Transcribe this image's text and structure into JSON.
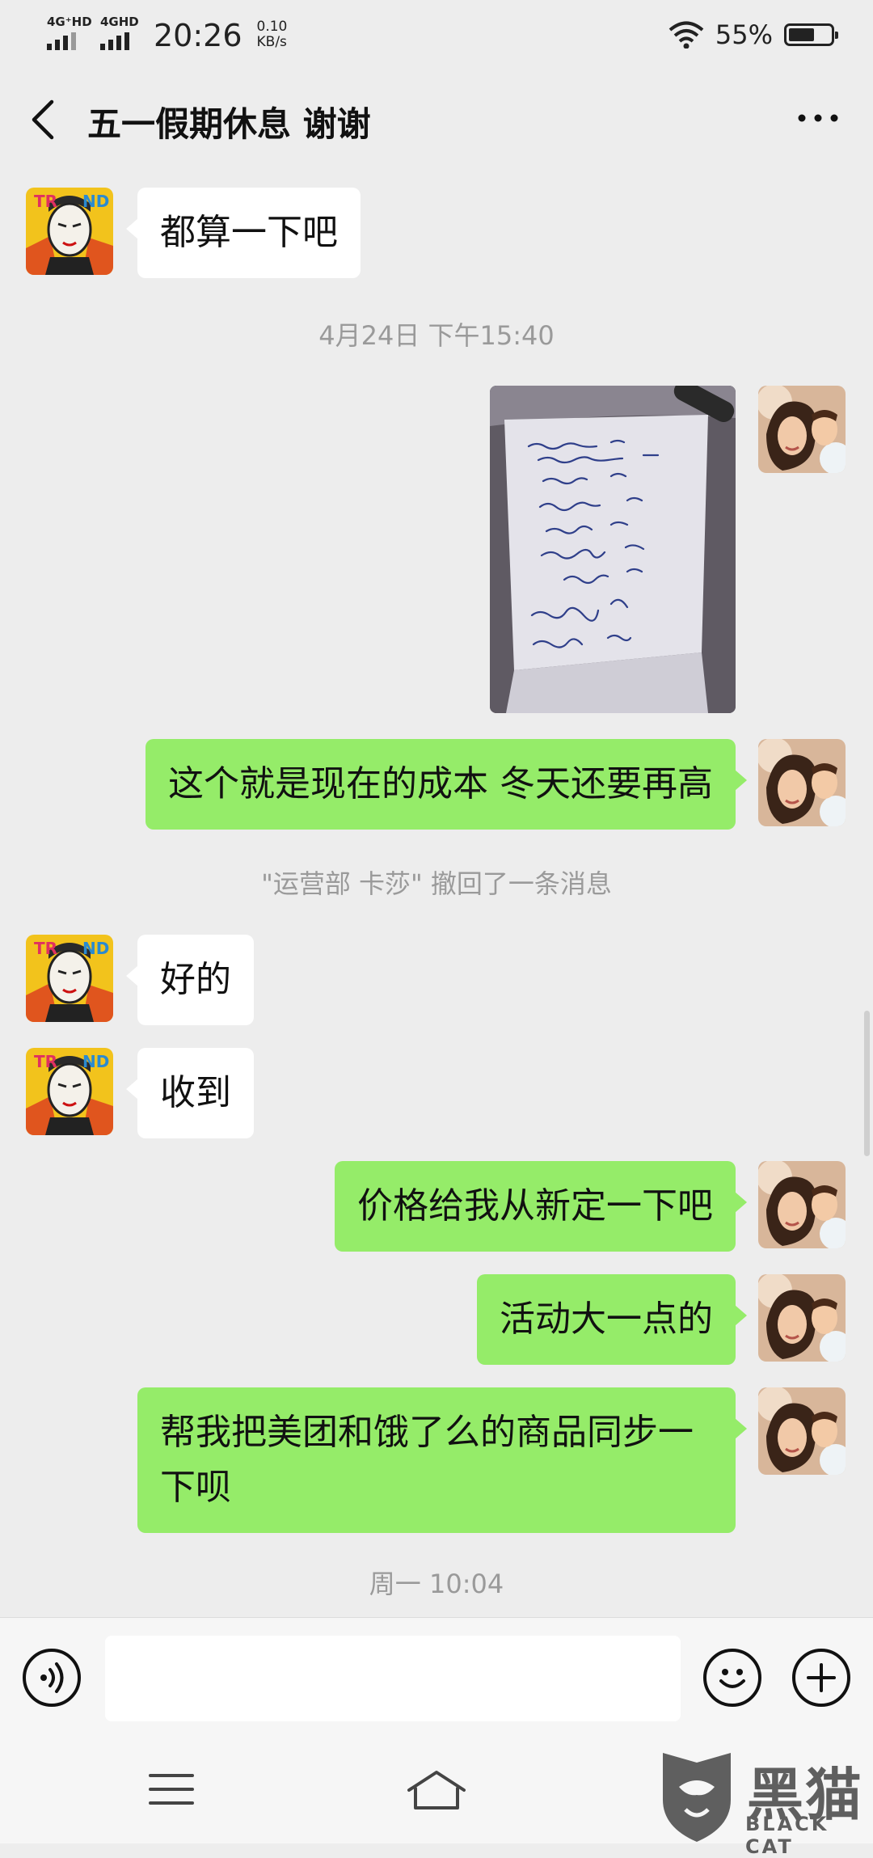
{
  "status_bar": {
    "network1": "4G⁺HD",
    "network2": "4GHD",
    "time": "20:26",
    "speed_value": "0.10",
    "speed_unit": "KB/s",
    "battery_percent": "55%",
    "battery_level": 0.55
  },
  "header": {
    "title": "五一假期休息 谢谢"
  },
  "messages": [
    {
      "side": "in",
      "text": "都算一下吧"
    },
    {
      "side": "system",
      "text": "4月24日 下午15:40"
    },
    {
      "side": "out",
      "type": "image",
      "icon": "handwritten-price-list-photo"
    },
    {
      "side": "out",
      "text": "这个就是现在的成本  冬天还要再高"
    },
    {
      "side": "system",
      "text": "\"运营部 卡莎\" 撤回了一条消息"
    },
    {
      "side": "in",
      "text": "好的"
    },
    {
      "side": "in",
      "text": "收到"
    },
    {
      "side": "out",
      "text": "价格给我从新定一下吧"
    },
    {
      "side": "out",
      "text": "活动大一点的"
    },
    {
      "side": "out",
      "text": "帮我把美团和饿了么的商品同步一下呗"
    },
    {
      "side": "system",
      "text": "周一 10:04"
    }
  ],
  "input_bar": {
    "voice_icon": "voice-icon",
    "emoji_icon": "emoji-icon",
    "add_icon": "plus-icon",
    "value": ""
  },
  "watermark": {
    "text": "黑猫",
    "sub": "BLACK CAT"
  },
  "colors": {
    "background": "#ededed",
    "outgoing_bubble": "#95ec69",
    "incoming_bubble": "#ffffff",
    "system_text": "#9a9a9a"
  }
}
